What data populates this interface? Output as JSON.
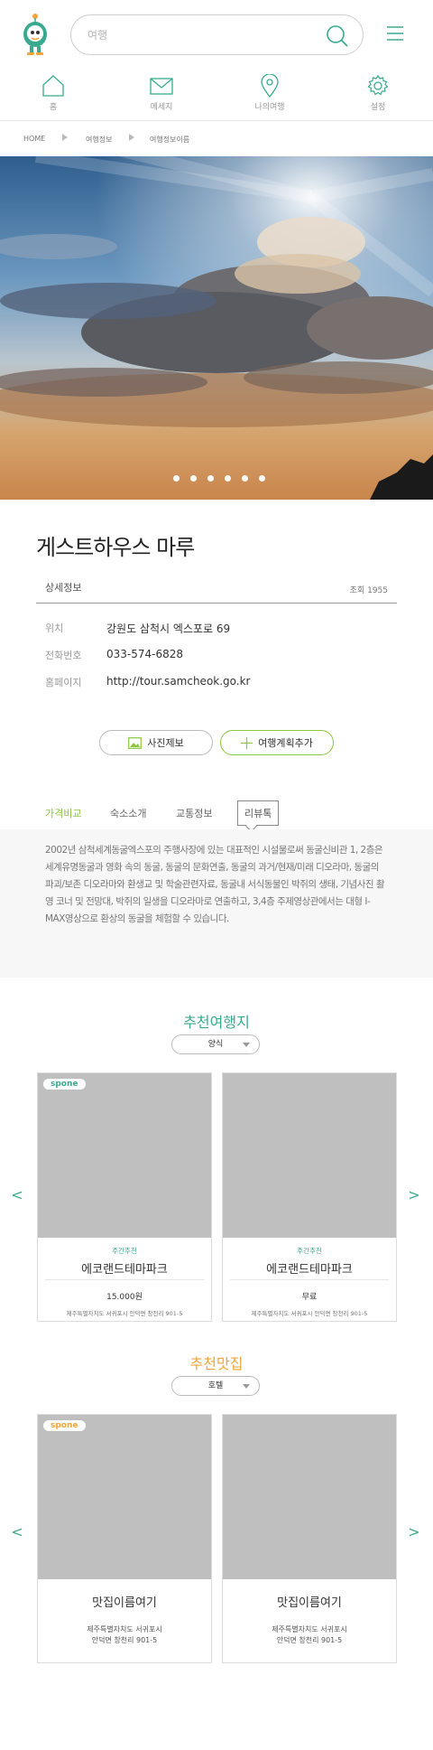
{
  "header": {
    "search_placeholder": "여행",
    "nav": [
      {
        "label": "홈",
        "icon": "home-icon"
      },
      {
        "label": "메세지",
        "icon": "mail-icon"
      },
      {
        "label": "나의여행",
        "icon": "location-pin-icon"
      },
      {
        "label": "설정",
        "icon": "gear-icon"
      }
    ]
  },
  "breadcrumb": [
    "HOME",
    "여행정보",
    "여행정보이름"
  ],
  "hero": {
    "slide_count": 6,
    "active_slide": 1
  },
  "place": {
    "title": "게스트하우스 마루",
    "detail_label": "상세정보",
    "views": "조회 1955",
    "rows": [
      {
        "key": "위치",
        "value": "강원도 삼척시 엑스포로 69"
      },
      {
        "key": "전화번호",
        "value": "033-574-6828"
      },
      {
        "key": "홈페이지",
        "value": "http://tour.samcheok.go.kr"
      }
    ]
  },
  "actions": {
    "photo": "사진제보",
    "plan": "여행계획추가"
  },
  "tabs": [
    "가격비교",
    "숙소소개",
    "교통정보",
    "리뷰톡"
  ],
  "description": "2002년 삼척세계동굴엑스포의 주행사장에 있는 대표적인 시설물로써 동굴신비관 1, 2층은 세계유명동굴과 영화 속의 동굴, 동굴의 문화연출, 동굴의 과거/현재/미래 디오라마, 동굴의 파괴/보존 디오라마와 환생교 및 학술관련자료, 동굴내 서식동물인 박쥐의 생태, 기념사진 촬영 코너 및 전망대, 박쥐의 일생을 디오라마로 연출하고, 3,4층 주제영상관에서는 대형 I-MAX영상으로 환상의 동굴을 체험할 수 있습니다.",
  "rec_travel": {
    "title": "추천여행지",
    "filter": "양식",
    "cards": [
      {
        "badge": "spone",
        "sub": "주간추천",
        "name": "에코랜드테마파크",
        "price": "15.000원",
        "addr": "제주특별자치도 서귀포시 안덕면 창천리 901-5"
      },
      {
        "badge": "",
        "sub": "주간추천",
        "name": "에코랜드테마파크",
        "price": "무료",
        "addr": "제주특별자치도 서귀포시 안덕면 창천리 901-5"
      }
    ]
  },
  "rec_food": {
    "title": "추천맛집",
    "filter": "호텔",
    "cards": [
      {
        "badge": "spone",
        "name": "맛집이름여기",
        "addr1": "제주특별자치도 서귀포시",
        "addr2": "안덕면 창천리 901-5"
      },
      {
        "badge": "",
        "name": "맛집이름여기",
        "addr1": "제주특별자치도 서귀포시",
        "addr2": "안덕면 창천리 901-5"
      }
    ]
  },
  "arrows": {
    "prev": "<",
    "next": ">"
  },
  "colors": {
    "accent_green": "#8cc63f",
    "teal": "#3aaa8f",
    "orange": "#f3a53a"
  }
}
